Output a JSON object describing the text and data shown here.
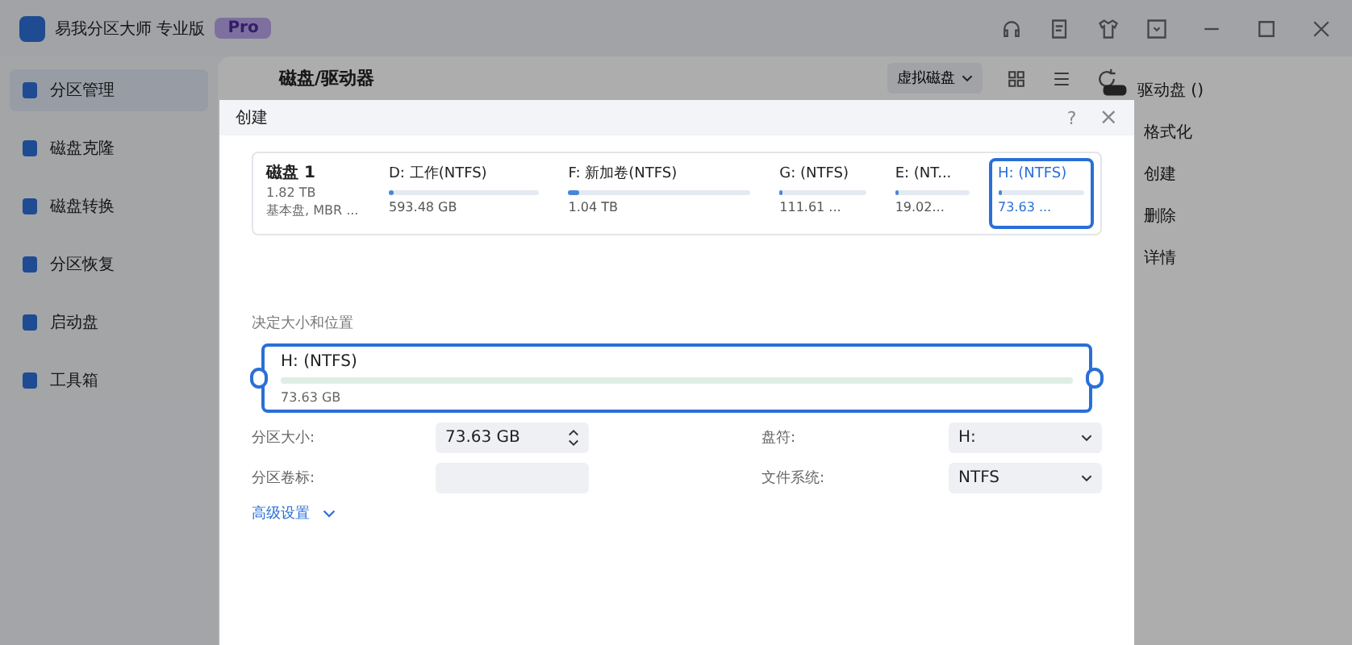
{
  "app": {
    "title": "易我分区大师 专业版",
    "badge": "Pro"
  },
  "sidebar": {
    "items": [
      {
        "label": "分区管理",
        "selected": true
      },
      {
        "label": "磁盘克隆",
        "selected": false
      },
      {
        "label": "磁盘转换",
        "selected": false
      },
      {
        "label": "分区恢复",
        "selected": false
      },
      {
        "label": "启动盘",
        "selected": false
      },
      {
        "label": "工具箱",
        "selected": false
      }
    ]
  },
  "main": {
    "heading": "磁盘/驱动器",
    "virtual_disk": "虚拟磁盘"
  },
  "right_panel": {
    "title": "驱动盘 ()",
    "actions": [
      "格式化",
      "创建",
      "删除",
      "详情"
    ]
  },
  "dialog": {
    "title": "创建",
    "help": "?",
    "close": "×",
    "disk": {
      "name": "磁盘 1",
      "size": "1.82 TB",
      "type": "基本盘, MBR ..."
    },
    "partitions": [
      {
        "label": "D: 工作(NTFS)",
        "size": "593.48 GB",
        "level": 0.02,
        "selected": false
      },
      {
        "label": "F: 新加卷(NTFS)",
        "size": "1.04 TB",
        "level": 0.06,
        "selected": false
      },
      {
        "label": "G: (NTFS)",
        "size": "111.61 ...",
        "level": 0.04,
        "selected": false
      },
      {
        "label": "E: (NT...",
        "size": "19.02...",
        "level": 0.04,
        "selected": false
      },
      {
        "label": "H: (NTFS)",
        "size": "73.63 ...",
        "level": 0.04,
        "selected": true
      }
    ],
    "section": "决定大小和位置",
    "slider": {
      "label": "H: (NTFS)",
      "size": "73.63 GB",
      "level": 1
    },
    "fields": [
      {
        "label": "分区大小:",
        "kind": "spinner",
        "value": "73.63 GB"
      },
      {
        "label": "盘符:",
        "kind": "select",
        "value": "H:"
      },
      {
        "label": "分区卷标:",
        "kind": "text"
      },
      {
        "label": "文件系统:",
        "kind": "select",
        "value": "NTFS"
      }
    ],
    "advanced": "高级设置"
  }
}
